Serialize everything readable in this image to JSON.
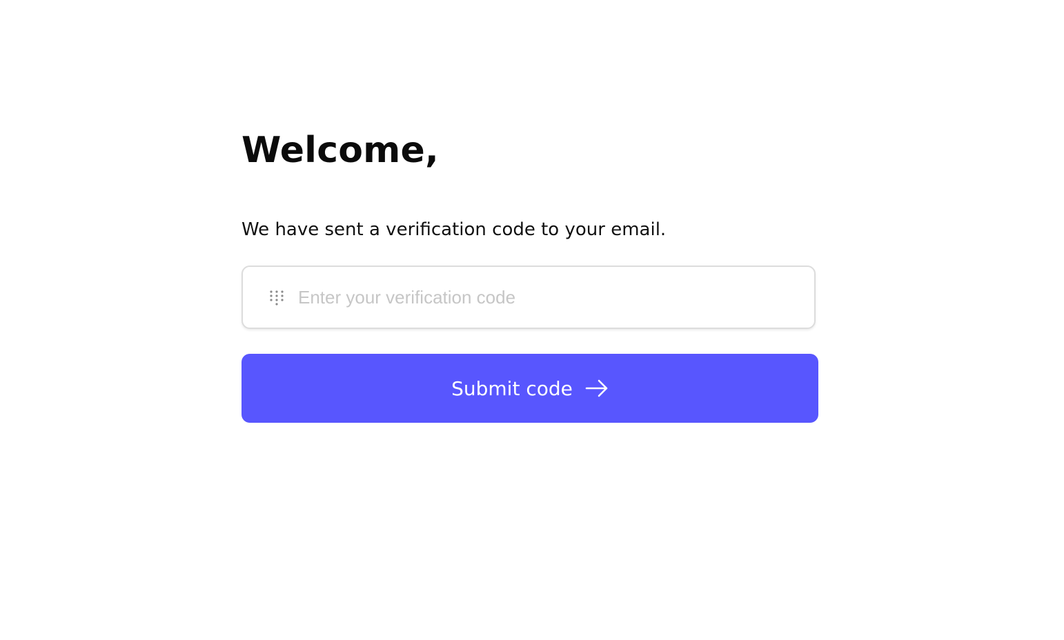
{
  "heading": "Welcome,",
  "message": "We have sent a verification code to your email.",
  "code_field": {
    "placeholder": "Enter your verification code",
    "value": "",
    "icon": "keypad-icon"
  },
  "submit_button": {
    "label": "Submit code",
    "icon": "arrow-right-icon",
    "color": "#5856fe"
  }
}
